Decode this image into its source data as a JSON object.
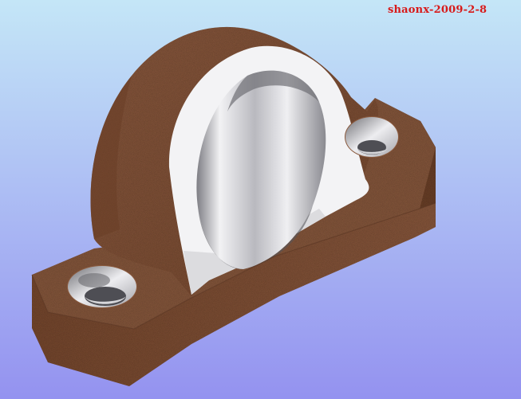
{
  "watermark": {
    "text": "shaonx-2009-2-8",
    "color": "#d81a1a"
  },
  "colors": {
    "background_top": "#c4e6f7",
    "background_bottom": "#9492f0",
    "housing": "#87563b",
    "housing_dark": "#5c3521",
    "housing_light": "#a87556",
    "bearing_face": "#f4f4f6",
    "bearing_shadow": "#9c9ca0",
    "bore": "#d6d6da"
  },
  "model": {
    "part": "pillow-block-bearing-housing",
    "mounting_holes": 2
  }
}
